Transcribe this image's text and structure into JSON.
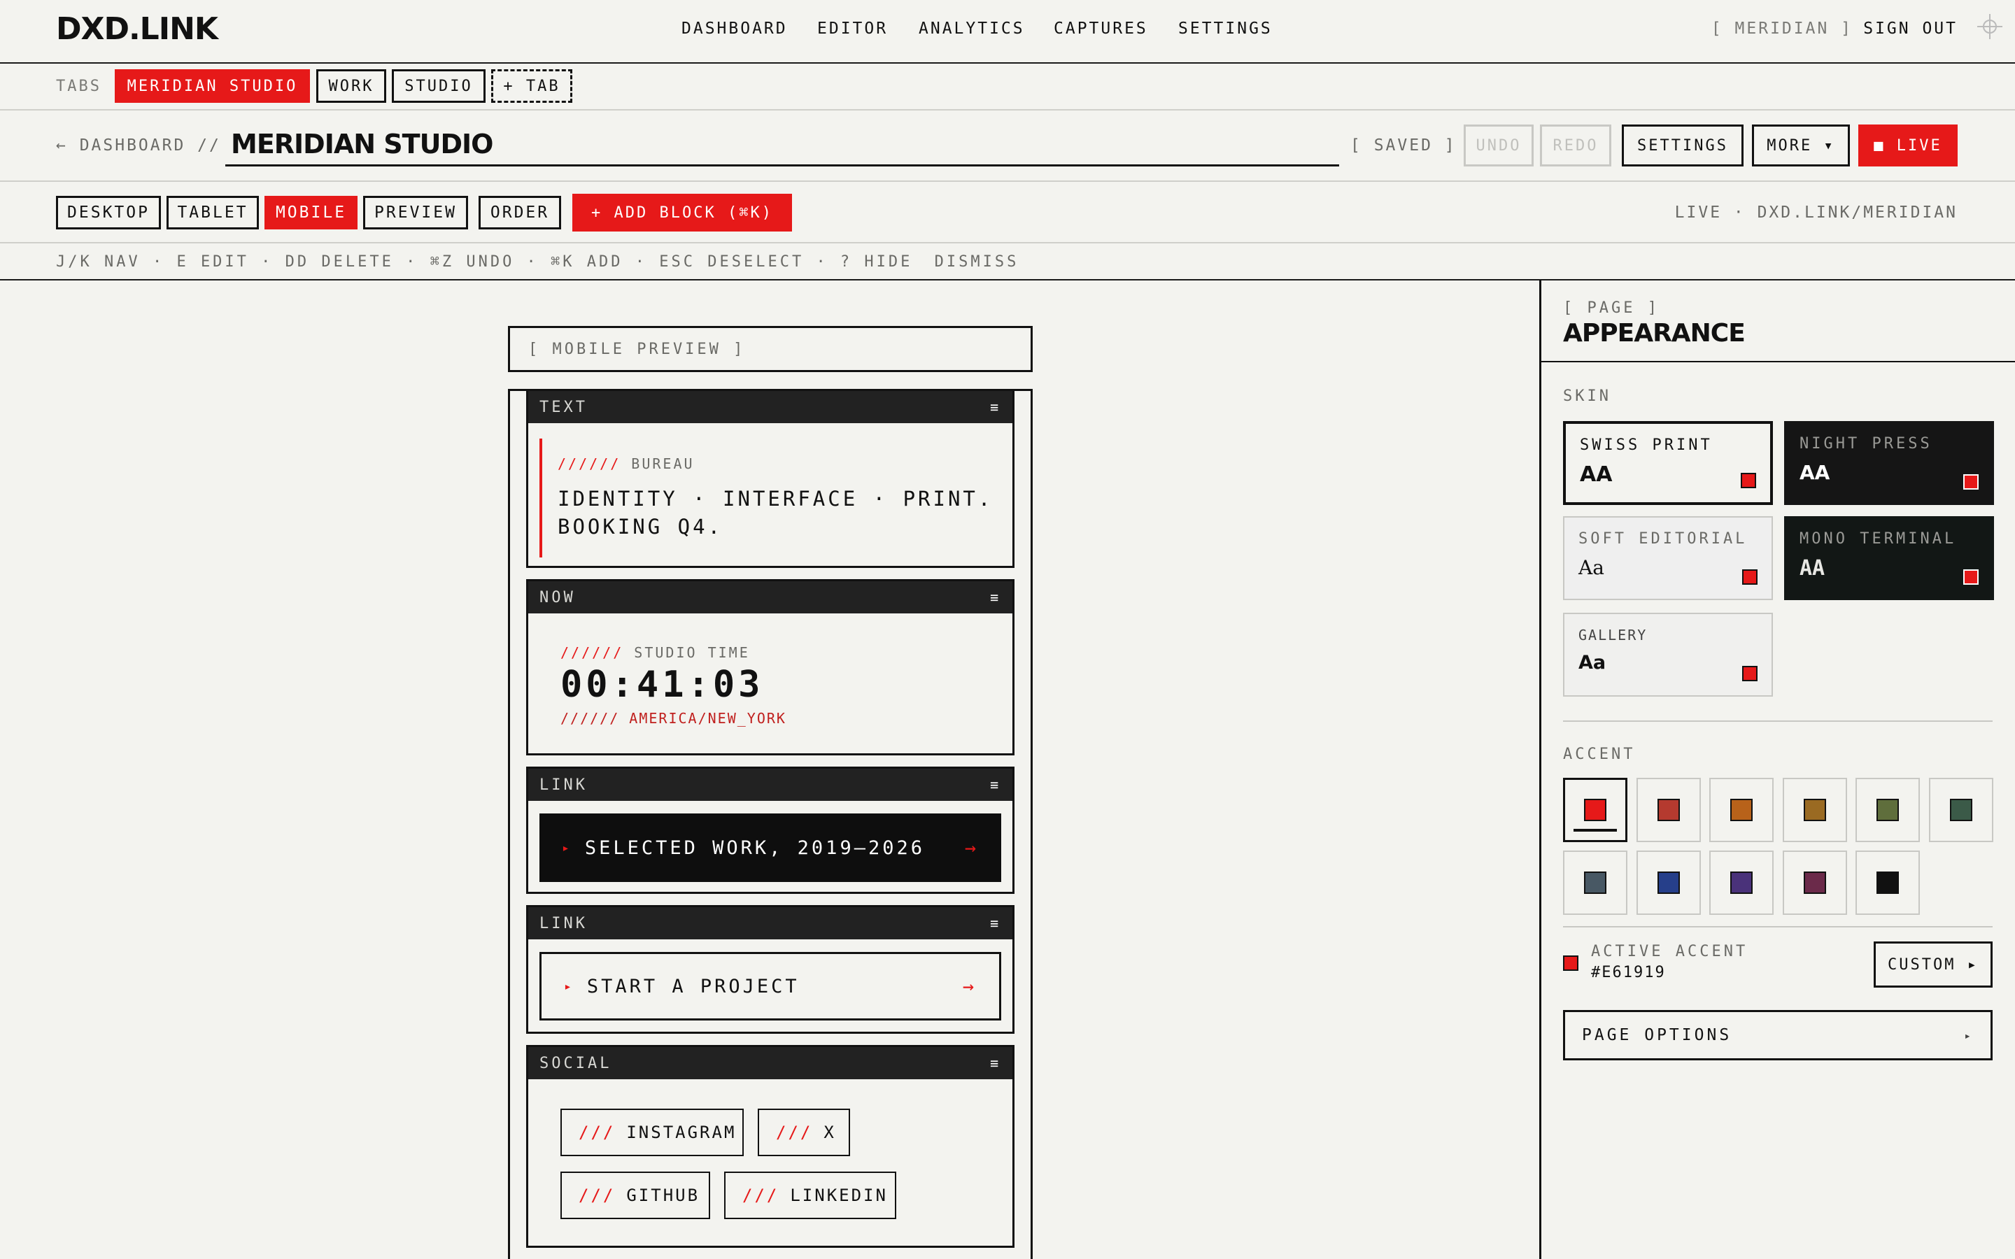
{
  "app": {
    "logo": "DXD.LINK"
  },
  "topnav": {
    "items": [
      "DASHBOARD",
      "EDITOR",
      "ANALYTICS",
      "CAPTURES",
      "SETTINGS"
    ],
    "workspace": "[ MERIDIAN ]",
    "signout": "SIGN OUT"
  },
  "tabs": {
    "label": "TABS",
    "items": [
      "MERIDIAN STUDIO",
      "WORK",
      "STUDIO"
    ],
    "add": "+ TAB",
    "active": 0
  },
  "titlebar": {
    "back": "← DASHBOARD //",
    "title": "MERIDIAN STUDIO",
    "saved": "[ SAVED ]",
    "undo": "UNDO",
    "redo": "REDO",
    "settings": "SETTINGS",
    "more": "MORE ▾",
    "live": "■ LIVE"
  },
  "devices": {
    "items": [
      "DESKTOP",
      "TABLET",
      "MOBILE",
      "PREVIEW",
      "ORDER"
    ],
    "active": 2,
    "add_block": "+ ADD BLOCK (⌘K)",
    "live_url": "LIVE · DXD.LINK/MERIDIAN"
  },
  "hints": {
    "text": "J/K NAV · E EDIT · DD DELETE · ⌘Z UNDO · ⌘K ADD · ESC DESELECT · ? HIDE",
    "dismiss": "DISMISS"
  },
  "preview": {
    "label": "[ MOBILE PREVIEW ]",
    "menu_glyph": "≡",
    "blocks": {
      "text": {
        "type": "TEXT",
        "kicker_slashes": "//////",
        "kicker": "BUREAU",
        "line1": "IDENTITY · INTERFACE · PRINT.",
        "line2": "BOOKING Q4."
      },
      "now": {
        "type": "NOW",
        "slashes": "//////",
        "label": "STUDIO TIME",
        "time": "00:41:03",
        "tz": "AMERICA/NEW_YORK"
      },
      "link1": {
        "type": "LINK",
        "prefix": "▸",
        "label": "SELECTED WORK, 2019—2026",
        "arrow": "→"
      },
      "link2": {
        "type": "LINK",
        "prefix": "▸",
        "label": "START A PROJECT",
        "arrow": "→"
      },
      "social": {
        "type": "SOCIAL",
        "slashes": "///",
        "items": [
          "INSTAGRAM",
          "X",
          "GITHUB",
          "LINKEDIN"
        ]
      }
    }
  },
  "panel": {
    "kicker": "[ PAGE ]",
    "title": "APPEARANCE",
    "skin_label": "SKIN",
    "skins": [
      {
        "name": "SWISS PRINT",
        "sample": "AA"
      },
      {
        "name": "NIGHT PRESS",
        "sample": "AA"
      },
      {
        "name": "SOFT EDITORIAL",
        "sample": "Aa"
      },
      {
        "name": "MONO TERMINAL",
        "sample": "AA"
      },
      {
        "name": "GALLERY",
        "sample": "Aa"
      }
    ],
    "accent_label": "ACCENT",
    "accents": [
      "#e61919",
      "#b53a2f",
      "#b8621a",
      "#9a6a22",
      "#5f6e3c",
      "#3b5a48",
      "#485864",
      "#263f8a",
      "#4a327a",
      "#6b2a4a",
      "#111111"
    ],
    "active_accent_label": "ACTIVE ACCENT",
    "active_accent_hex": "#E61919",
    "custom": "CUSTOM ▸",
    "page_options": "PAGE OPTIONS",
    "page_options_arrow": "▸"
  },
  "colors": {
    "accent": "#e61919",
    "ink": "#111111",
    "paper": "#f3f3ef"
  }
}
